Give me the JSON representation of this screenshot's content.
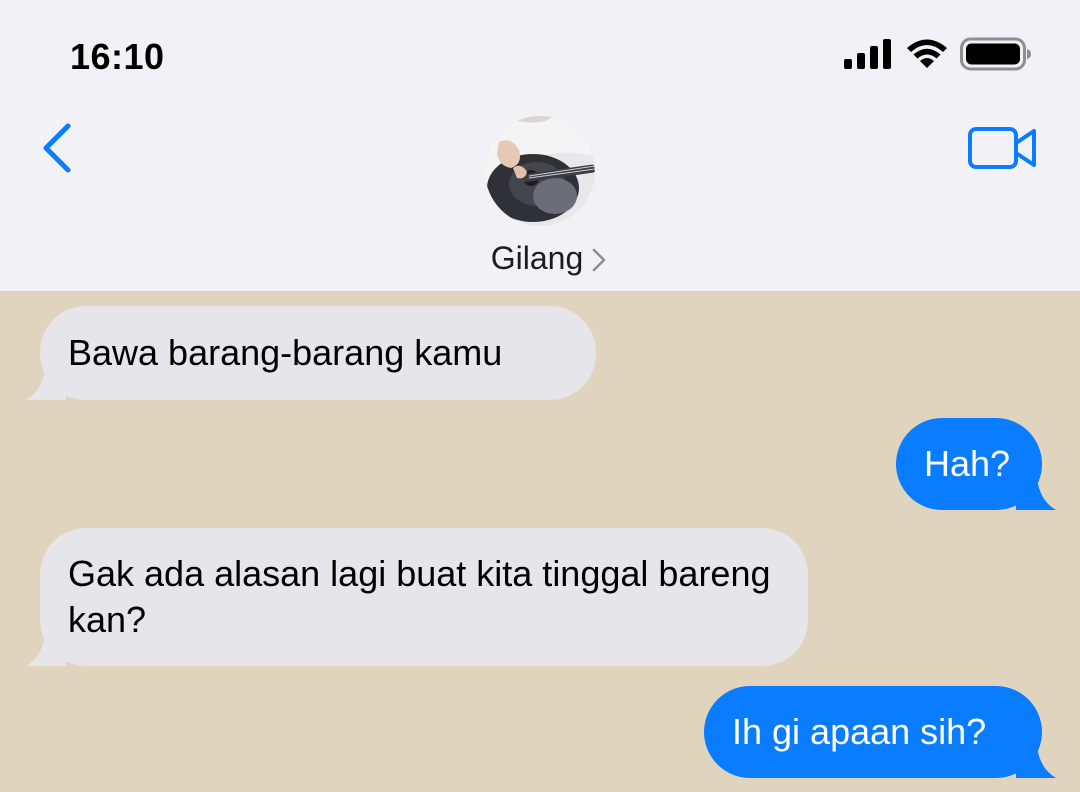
{
  "status_bar": {
    "time": "16:10",
    "signal_icon": "cellular-signal-icon",
    "wifi_icon": "wifi-icon",
    "battery_icon": "battery-full-icon"
  },
  "nav": {
    "back_icon": "chevron-left-icon",
    "video_icon": "video-camera-icon",
    "contact_name": "Gilang",
    "contact_chevron_icon": "chevron-right-icon",
    "avatar_description_icon": "guitar-avatar"
  },
  "colors": {
    "accent": "#0a7cff",
    "incoming_bubble": "#e5e5ea",
    "chat_background": "#e1d4be",
    "header_background": "#f1f1f6"
  },
  "messages": [
    {
      "direction": "incoming",
      "text": "Bawa barang-barang kamu"
    },
    {
      "direction": "outgoing",
      "text": "Hah?"
    },
    {
      "direction": "incoming",
      "text": "Gak ada alasan lagi buat kita tinggal bareng kan?"
    },
    {
      "direction": "outgoing",
      "text": "Ih gi apaan sih?"
    }
  ]
}
